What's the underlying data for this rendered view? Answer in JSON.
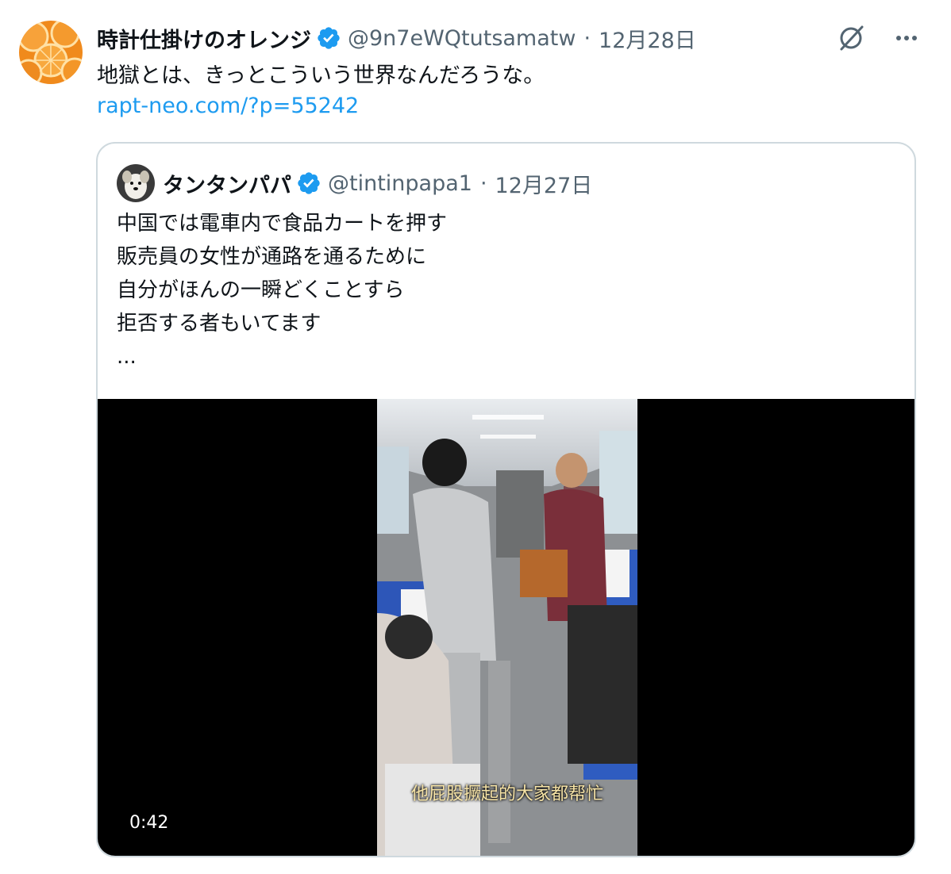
{
  "tweet": {
    "display_name": "時計仕掛けのオレンジ",
    "handle": "@9n7eWQtutsamatw",
    "separator": "·",
    "date": "12月28日",
    "text": "地獄とは、きっとこういう世界なんだろうな。",
    "link": "rapt-neo.com/?p=55242",
    "avatar_icon": "orange-slices-avatar",
    "verified_icon": "verified-badge-icon",
    "grok_icon": "grok-slash-icon",
    "more_icon": "more-dots-icon"
  },
  "quoted_tweet": {
    "display_name": "タンタンパパ",
    "handle": "@tintinpapa1",
    "separator": "·",
    "date": "12月27日",
    "avatar_icon": "dog-avatar",
    "verified_icon": "verified-badge-icon",
    "text_lines": [
      "中国では電車内で食品カートを押す",
      "販売員の女性が通路を通るために",
      "自分がほんの一瞬どくことすら",
      "拒否する者もいてます",
      "..."
    ],
    "video": {
      "subtitle": "他屁股撅起的大家都帮忙",
      "duration": "0:42"
    }
  },
  "colors": {
    "accent": "#1d9bf0",
    "verified": "#1d9bf0",
    "secondary_text": "#536471",
    "border": "#cfd9de"
  }
}
